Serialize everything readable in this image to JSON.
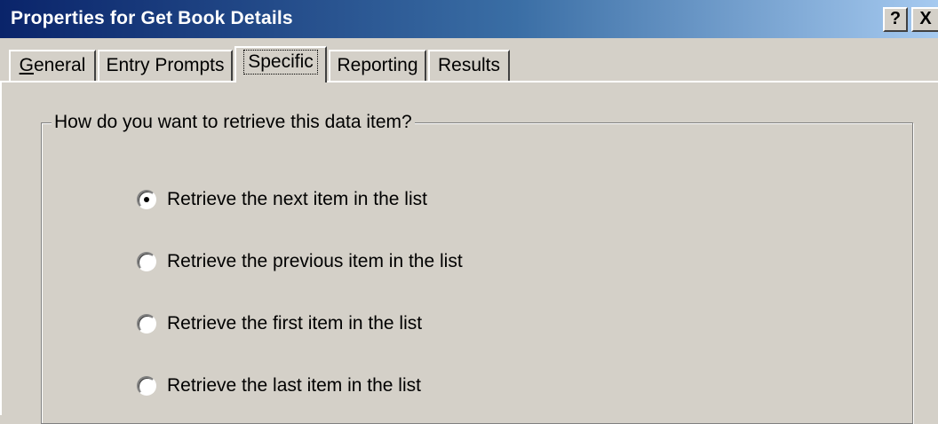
{
  "window": {
    "title": "Properties for Get Book Details",
    "help_label": "?",
    "close_label": "X"
  },
  "tabs": [
    {
      "pre": "",
      "underline": "G",
      "post": "eneral",
      "active": false
    },
    {
      "pre": "",
      "underline": "",
      "post": "Entry Prompts",
      "active": false
    },
    {
      "pre": "",
      "underline": "",
      "post": "Specific",
      "active": true
    },
    {
      "pre": "",
      "underline": "",
      "post": "Reporting",
      "active": false
    },
    {
      "pre": "",
      "underline": "",
      "post": "Results",
      "active": false
    }
  ],
  "group": {
    "label": "How do you want to retrieve this data item?",
    "options": [
      {
        "label": "Retrieve the next item in the list",
        "checked": true
      },
      {
        "label": "Retrieve the previous item in the list",
        "checked": false
      },
      {
        "label": "Retrieve the first item in the list",
        "checked": false
      },
      {
        "label": "Retrieve the last item in the list",
        "checked": false
      }
    ]
  }
}
